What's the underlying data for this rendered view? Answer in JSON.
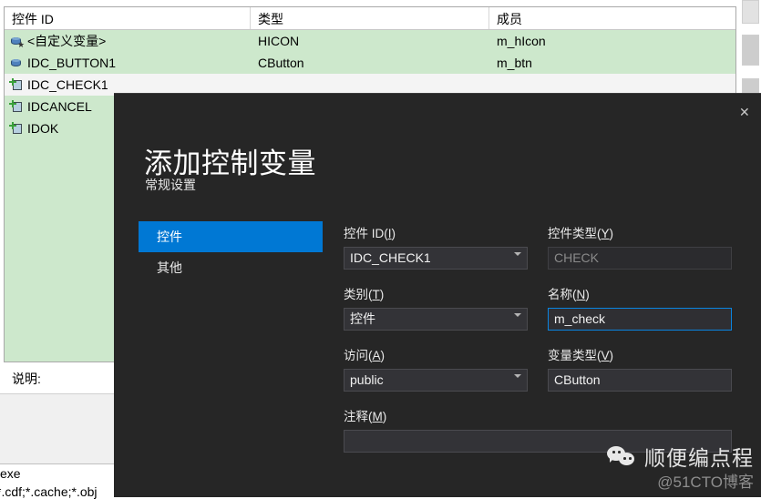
{
  "background": {
    "list": {
      "columns": [
        "控件 ID",
        "类型",
        "成员"
      ],
      "rows": [
        {
          "icon": "variable-icon",
          "id": "<自定义变量>",
          "type": "HICON",
          "member": "m_hIcon",
          "selected": false
        },
        {
          "icon": "variable-icon",
          "id": "IDC_BUTTON1",
          "type": "CButton",
          "member": "m_btn",
          "selected": false
        },
        {
          "icon": "control-icon",
          "id": "IDC_CHECK1",
          "type": "",
          "member": "",
          "selected": true
        },
        {
          "icon": "control-icon",
          "id": "IDCANCEL",
          "type": "",
          "member": "",
          "selected": false
        },
        {
          "icon": "control-icon",
          "id": "IDOK",
          "type": "",
          "member": "",
          "selected": false
        }
      ]
    },
    "description_label": "说明:",
    "bottom_line_1": "exe",
    "bottom_line_2": "*.cdf;*.cache;*.obj"
  },
  "dialog": {
    "title": "添加控制变量",
    "subtitle": "常规设置",
    "close_label": "✕",
    "nav": [
      {
        "label": "控件",
        "active": true
      },
      {
        "label": "其他",
        "active": false
      }
    ],
    "fields": {
      "control_id": {
        "label_text": "控件 ID(",
        "label_key": "I",
        "label_tail": ")",
        "value": "IDC_CHECK1"
      },
      "control_type": {
        "label_text": "控件类型(",
        "label_key": "Y",
        "label_tail": ")",
        "value": "CHECK"
      },
      "category": {
        "label_text": "类别(",
        "label_key": "T",
        "label_tail": ")",
        "value": "控件"
      },
      "name": {
        "label_text": "名称(",
        "label_key": "N",
        "label_tail": ")",
        "value": "m_check"
      },
      "access": {
        "label_text": "访问(",
        "label_key": "A",
        "label_tail": ")",
        "value": "public"
      },
      "variable_type": {
        "label_text": "变量类型(",
        "label_key": "V",
        "label_tail": ")",
        "value": "CButton"
      },
      "comment": {
        "label_text": "注释(",
        "label_key": "M",
        "label_tail": ")",
        "value": ""
      }
    }
  },
  "watermark": {
    "name": "顺便编点程",
    "sub": "@51CTO博客"
  },
  "colors": {
    "accent_blue": "#0078D4",
    "dialog_bg": "#262626",
    "list_green": "#CDE8CC",
    "focus_border": "#0A84E0"
  }
}
